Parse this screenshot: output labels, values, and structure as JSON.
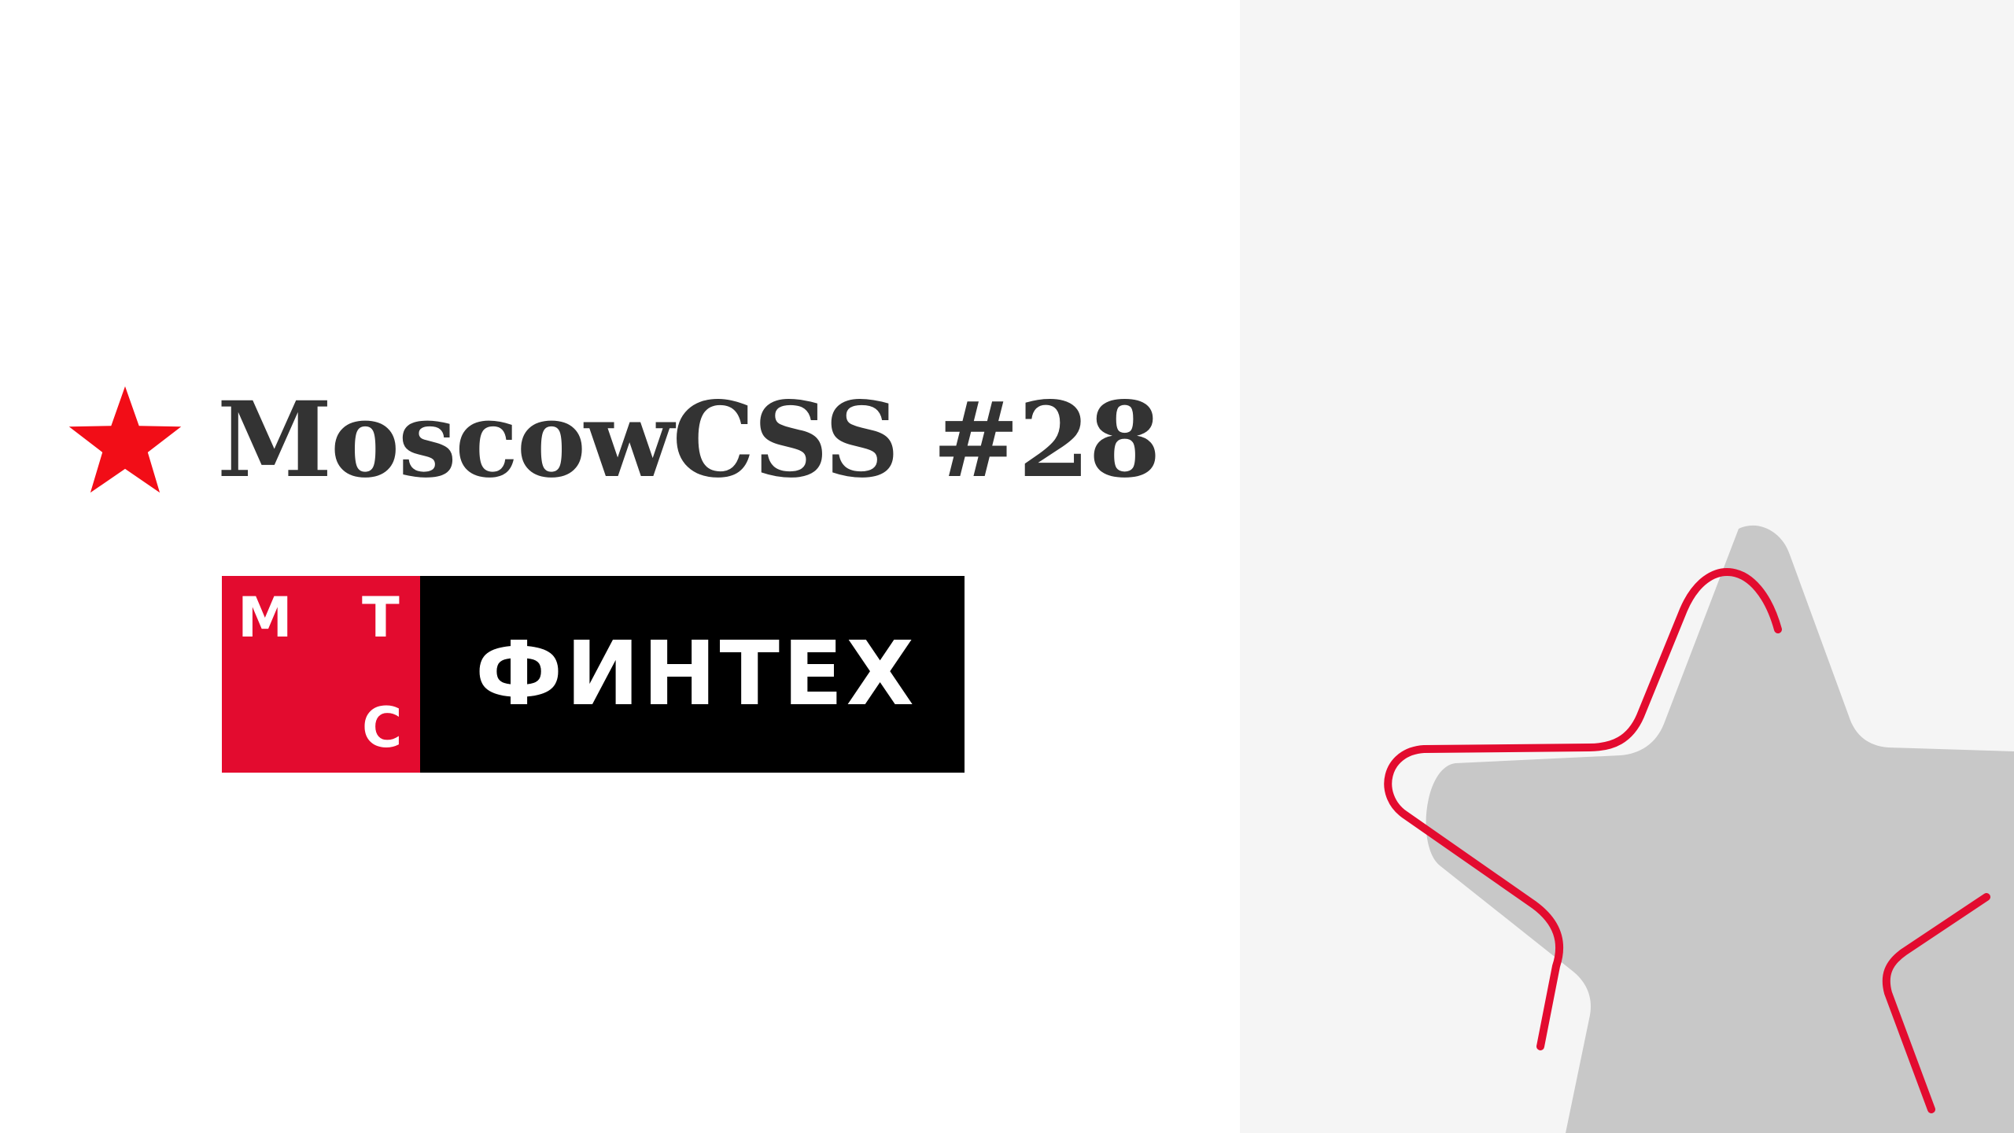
{
  "slide": {
    "title": "MoscowCSS #28",
    "logo": {
      "letter_m": "М",
      "letter_t": "Т",
      "letter_s": "С",
      "word": "ФИНТЕХ"
    }
  },
  "colors": {
    "accent_red": "#e30b2f",
    "title_text": "#333333",
    "logo_black": "#000000",
    "panel_gray": "#f5f5f5",
    "star_gray": "#c8c8c8"
  },
  "icons": {
    "title_star": "red-star-icon",
    "decoration": "outline-star-icon"
  }
}
